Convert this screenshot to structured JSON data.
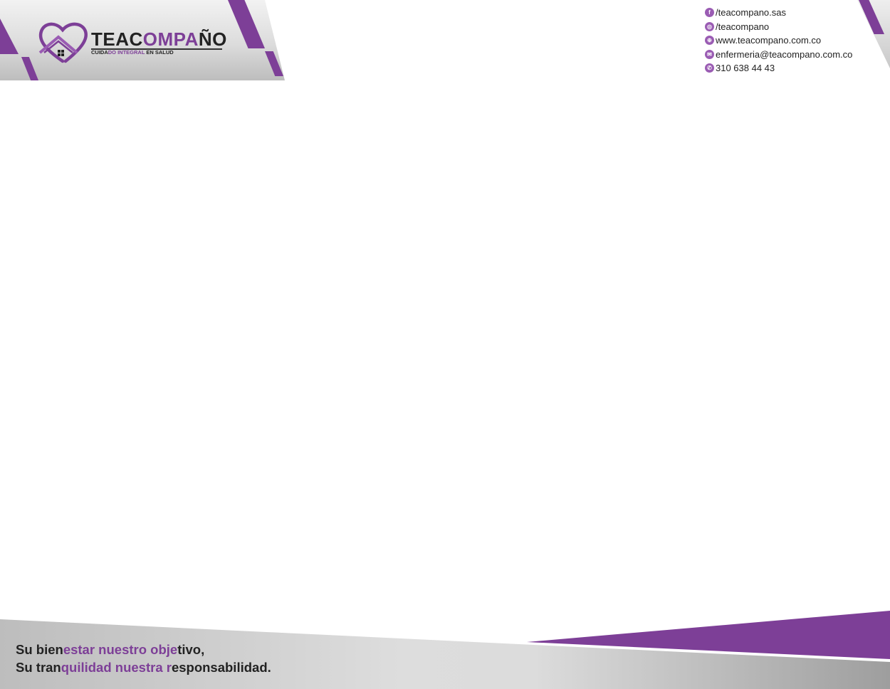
{
  "colors": {
    "accent": "#7d3f97",
    "accent_light": "#9a5cb3",
    "dark_text": "#222222"
  },
  "brand": {
    "name_part1": "TEAC",
    "name_part2": "OMPA",
    "name_part3": "ÑO",
    "tagline_part1": "CUIDA",
    "tagline_part2": "DO INTEGRAL",
    "tagline_part3": " EN SALUD",
    "logo_icon": "heart-house-icon"
  },
  "contacts": [
    {
      "icon": "facebook-icon",
      "glyph": "f",
      "text": "/teacompano.sas"
    },
    {
      "icon": "instagram-icon",
      "glyph": "◎",
      "text": "/teacompano"
    },
    {
      "icon": "globe-icon",
      "glyph": "⊕",
      "text": "www.teacompano.com.co"
    },
    {
      "icon": "mail-icon",
      "glyph": "✉",
      "text": "enfermeria@teacompano.com.co"
    },
    {
      "icon": "whatsapp-icon",
      "glyph": "✆",
      "text": "310 638 44 43"
    }
  ],
  "slogan": {
    "line1": {
      "a": "Su bien",
      "b": "estar nuestro obje",
      "c": "tivo,"
    },
    "line2": {
      "a": "Su tran",
      "b": "quilidad nuestra r",
      "c": "esponsabilidad."
    }
  }
}
